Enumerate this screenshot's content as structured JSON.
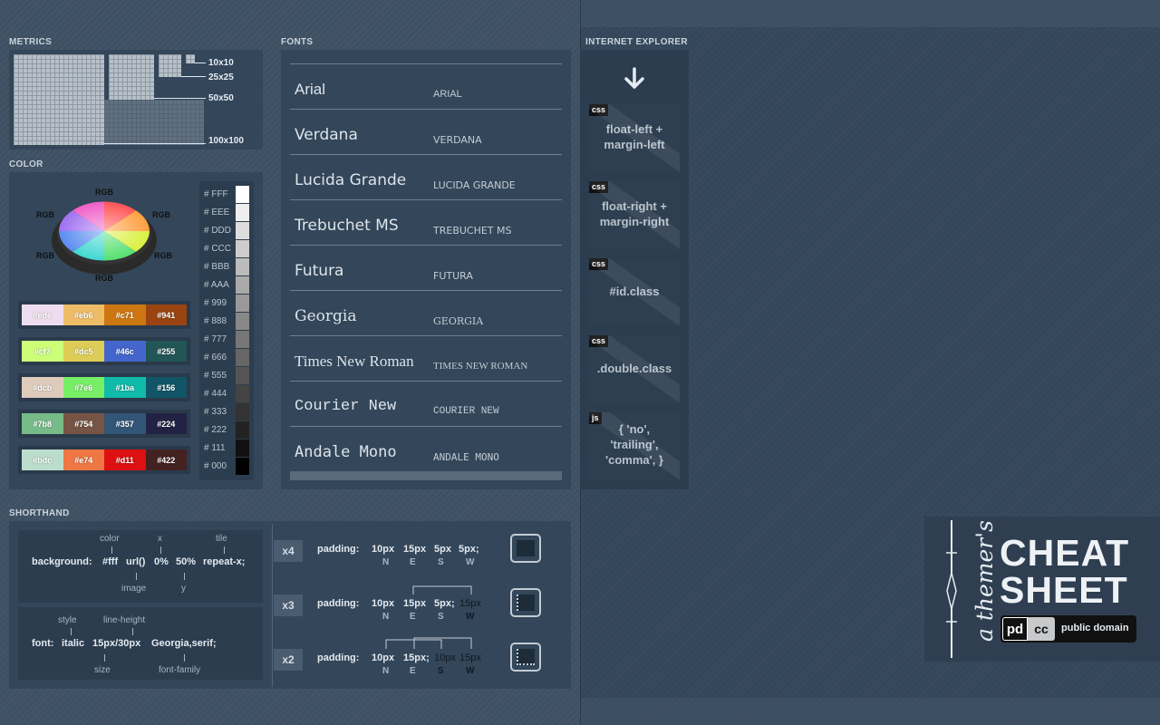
{
  "sections": {
    "metrics": "METRICS",
    "color": "COLOR",
    "fonts": "FONTS",
    "ie": "INTERNET EXPLORER",
    "shorthand": "SHORTHAND"
  },
  "metrics": {
    "labels": [
      "10x10",
      "25x25",
      "50x50",
      "100x100"
    ]
  },
  "color": {
    "rgb_labels": [
      "RGB",
      "RGB",
      "RGB",
      "RGB",
      "RGB",
      "RGB"
    ],
    "swatch_rows": [
      [
        {
          "label": "#ede",
          "color": "#eeddee"
        },
        {
          "label": "#eb6",
          "color": "#eebb66"
        },
        {
          "label": "#c71",
          "color": "#cc7711"
        },
        {
          "label": "#941",
          "color": "#994411"
        }
      ],
      [
        {
          "label": "#cf7",
          "color": "#ccff77"
        },
        {
          "label": "#dc5",
          "color": "#ddcc55"
        },
        {
          "label": "#46c",
          "color": "#4466cc"
        },
        {
          "label": "#255",
          "color": "#225555"
        }
      ],
      [
        {
          "label": "#dcb",
          "color": "#ddccbb"
        },
        {
          "label": "#7e6",
          "color": "#77ee66"
        },
        {
          "label": "#1ba",
          "color": "#11bbaa"
        },
        {
          "label": "#156",
          "color": "#115566"
        }
      ],
      [
        {
          "label": "#7b8",
          "color": "#77bb88"
        },
        {
          "label": "#754",
          "color": "#775544"
        },
        {
          "label": "#357",
          "color": "#335577"
        },
        {
          "label": "#224",
          "color": "#222244"
        }
      ],
      [
        {
          "label": "#bdc",
          "color": "#bbddcc"
        },
        {
          "label": "#e74",
          "color": "#ee7744"
        },
        {
          "label": "#d11",
          "color": "#dd1111"
        },
        {
          "label": "#422",
          "color": "#442222"
        }
      ]
    ],
    "grays": [
      {
        "label": "# FFF",
        "color": "#ffffff"
      },
      {
        "label": "# EEE",
        "color": "#eeeeee"
      },
      {
        "label": "# DDD",
        "color": "#dddddd"
      },
      {
        "label": "# CCC",
        "color": "#cccccc"
      },
      {
        "label": "# BBB",
        "color": "#bbbbbb"
      },
      {
        "label": "# AAA",
        "color": "#aaaaaa"
      },
      {
        "label": "# 999",
        "color": "#999999"
      },
      {
        "label": "# 888",
        "color": "#888888"
      },
      {
        "label": "# 777",
        "color": "#777777"
      },
      {
        "label": "# 666",
        "color": "#666666"
      },
      {
        "label": "# 555",
        "color": "#555555"
      },
      {
        "label": "# 444",
        "color": "#444444"
      },
      {
        "label": "# 333",
        "color": "#333333"
      },
      {
        "label": "# 222",
        "color": "#222222"
      },
      {
        "label": "# 111",
        "color": "#111111"
      },
      {
        "label": "# 000",
        "color": "#000000"
      }
    ]
  },
  "fonts": [
    {
      "name": "Arial",
      "caption": "ARIAL"
    },
    {
      "name": "Verdana",
      "caption": "VERDANA"
    },
    {
      "name": "Lucida Grande",
      "caption": "LUCIDA GRANDE"
    },
    {
      "name": "Trebuchet MS",
      "caption": "TREBUCHET MS"
    },
    {
      "name": "Futura",
      "caption": "FUTURA"
    },
    {
      "name": "Georgia",
      "caption": "GEORGIA"
    },
    {
      "name": "Times New Roman",
      "caption": "TIMES NEW ROMAN"
    },
    {
      "name": "Courier New",
      "caption": "COURIER NEW"
    },
    {
      "name": "Andale Mono",
      "caption": "ANDALE MONO"
    }
  ],
  "ie": {
    "arrow": "down-arrow-icon",
    "cards": [
      {
        "tag": "css",
        "line1": "float-left +",
        "line2": "margin-left",
        "line3": ""
      },
      {
        "tag": "css",
        "line1": "float-right +",
        "line2": "margin-right",
        "line3": ""
      },
      {
        "tag": "css",
        "line1": "#id.class",
        "line2": "",
        "line3": ""
      },
      {
        "tag": "css",
        "line1": ".double.class",
        "line2": "",
        "line3": ""
      },
      {
        "tag": "js",
        "line1": "{ 'no',",
        "line2": "'trailing',",
        "line3": "'comma', }"
      }
    ]
  },
  "shorthand": {
    "background": {
      "top_labels": [
        "color",
        "x",
        "tile"
      ],
      "main": [
        "background:",
        "#fff",
        "url()",
        "0%",
        "50%",
        "repeat-x;"
      ],
      "bottom_labels": [
        "image",
        "y"
      ]
    },
    "font": {
      "top_labels": [
        "style",
        "line-height"
      ],
      "main": [
        "font:",
        "italic",
        "15px/30px",
        "Georgia,serif;"
      ],
      "bottom_labels": [
        "size",
        "font-family"
      ]
    },
    "padding_rows": [
      {
        "mult": "x4",
        "label": "padding:",
        "values": [
          "10px",
          "15px",
          "5px",
          "5px;"
        ],
        "dirs": [
          "N",
          "E",
          "S",
          "W"
        ]
      },
      {
        "mult": "x3",
        "label": "padding:",
        "values": [
          "10px",
          "15px",
          "5px;",
          "15px"
        ],
        "dirs": [
          "N",
          "E",
          "S",
          "W"
        ]
      },
      {
        "mult": "x2",
        "label": "padding:",
        "values": [
          "10px",
          "15px;",
          "10px",
          "15px"
        ],
        "dirs": [
          "N",
          "E",
          "S",
          "W"
        ]
      }
    ]
  },
  "badge": {
    "script": "a themer's",
    "line1": "CHEAT",
    "line2": "SHEET",
    "pd": "pd",
    "cc": "cc",
    "license": "public domain"
  }
}
